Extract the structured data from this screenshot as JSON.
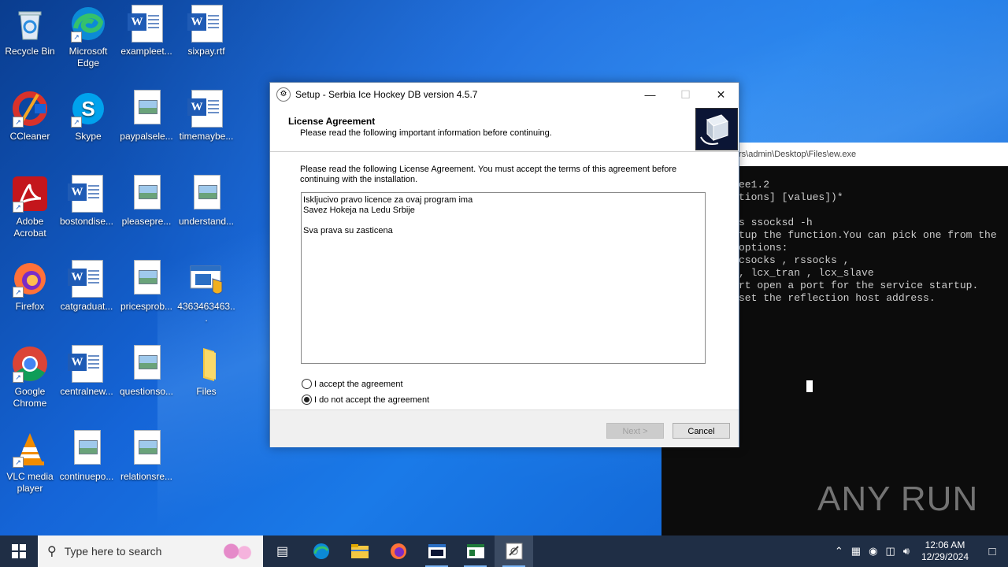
{
  "desktop": {
    "icons": [
      {
        "label": "Recycle Bin",
        "icon": "recycle-bin-icon"
      },
      {
        "label": "Microsoft Edge",
        "icon": "edge-icon"
      },
      {
        "label": "exampleet...",
        "icon": "word-doc-icon"
      },
      {
        "label": "sixpay.rtf",
        "icon": "word-doc-icon"
      },
      {
        "label": "CCleaner",
        "icon": "ccleaner-icon"
      },
      {
        "label": "Skype",
        "icon": "skype-icon"
      },
      {
        "label": "paypalsele...",
        "icon": "image-doc-icon"
      },
      {
        "label": "timemaybe...",
        "icon": "word-doc-icon"
      },
      {
        "label": "Adobe Acrobat",
        "icon": "acrobat-icon"
      },
      {
        "label": "bostondise...",
        "icon": "word-doc-icon"
      },
      {
        "label": "pleasepre...",
        "icon": "image-doc-icon"
      },
      {
        "label": "understand...",
        "icon": "image-doc-icon"
      },
      {
        "label": "Firefox",
        "icon": "firefox-icon"
      },
      {
        "label": "catgraduat...",
        "icon": "word-doc-icon"
      },
      {
        "label": "pricesprob...",
        "icon": "image-doc-icon"
      },
      {
        "label": "4363463463...",
        "icon": "installer-icon"
      },
      {
        "label": "Google Chrome",
        "icon": "chrome-icon"
      },
      {
        "label": "centralnew...",
        "icon": "word-doc-icon"
      },
      {
        "label": "questionso...",
        "icon": "image-doc-icon"
      },
      {
        "label": "Files",
        "icon": "folder-icon"
      },
      {
        "label": "VLC media player",
        "icon": "vlc-icon"
      },
      {
        "label": "continuepo...",
        "icon": "image-doc-icon"
      },
      {
        "label": "relationsre...",
        "icon": "image-doc-icon"
      }
    ]
  },
  "setup": {
    "title": "Setup - Serbia Ice Hockey DB version 4.5.7",
    "heading": "License Agreement",
    "subheading": "Please read the following important information before continuing.",
    "intro": "Please read the following License Agreement. You must accept the terms of this agreement before continuing with the installation.",
    "license_lines": [
      "Iskljucivo pravo licence za ovaj program ima",
      "Savez Hokeja na Ledu Srbije",
      "",
      "Sva prava su zasticena"
    ],
    "radio_accept": "I accept the agreement",
    "radio_decline": "I do not accept the agreement",
    "selected": "decline",
    "next_label": "Next >",
    "cancel_label": "Cancel"
  },
  "console": {
    "title": "rs\\admin\\Desktop\\Files\\ew.exe",
    "lines": [
      "ee1.2",
      "tions] [values])*",
      "",
      "s ssocksd -h",
      "tup the function.You can pick one from the",
      "options:",
      "csocks , rssocks ,",
      ", lcx_tran , lcx_slave",
      "rt open a port for the service startup.",
      "set the reflection host address."
    ],
    "watermark": "ANY RUN"
  },
  "taskbar": {
    "search_placeholder": "Type here to search",
    "time": "12:06 AM",
    "date": "12/29/2024"
  },
  "colors": {
    "desktop": "#1565d8",
    "taskbar": "#1f2e45",
    "accent": "#0078d7"
  }
}
